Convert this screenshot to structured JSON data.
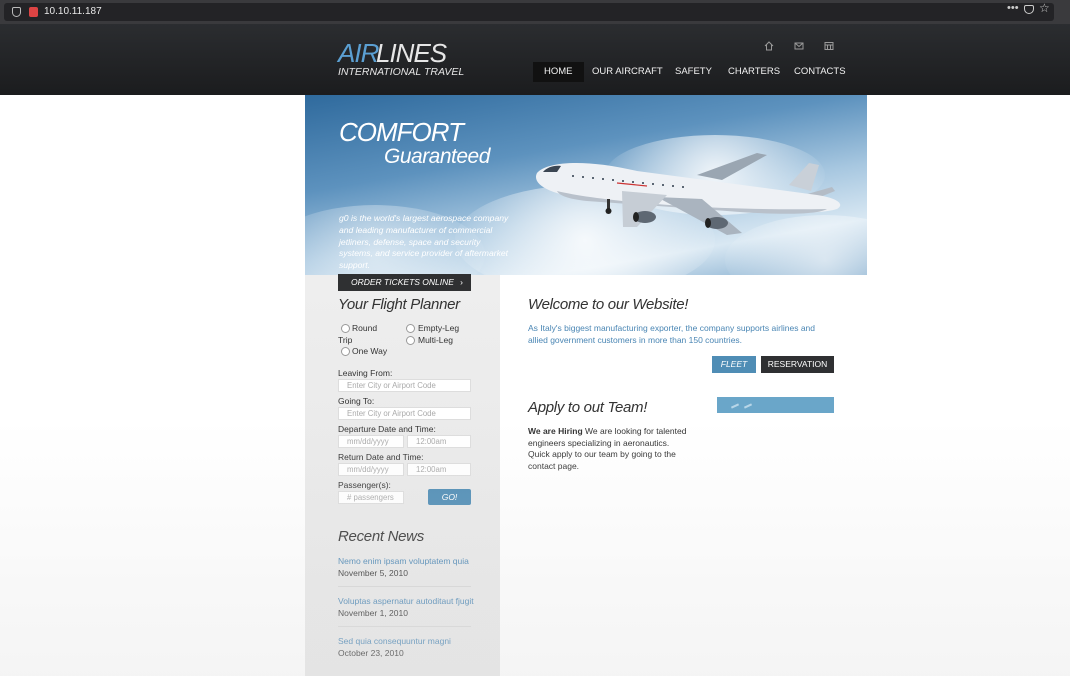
{
  "browser": {
    "url": "10.10.11.187",
    "menu_icon": "•••",
    "bookmark_icon": "☆"
  },
  "header": {
    "logo_air": "AIR",
    "logo_lines": "LINES",
    "logo_sub": "INTERNATIONAL TRAVEL",
    "icons": [
      "home-icon",
      "mail-icon",
      "sitemap-icon"
    ],
    "nav": [
      "HOME",
      "OUR AIRCRAFT",
      "SAFETY",
      "CHARTERS",
      "CONTACTS"
    ]
  },
  "hero": {
    "title": "COMFORT",
    "subtitle": "Guaranteed",
    "text": "g0 is the world's largest aerospace company and leading manufacturer of commercial jetliners, defense, space and security systems, and service provider of aftermarket support."
  },
  "sidebar": {
    "order_button": "ORDER TICKETS ONLINE",
    "order_chevron": "›",
    "planner_title": "Your Flight Planner",
    "trip_options": {
      "round": "Round",
      "trip": "Trip",
      "empty_leg": "Empty-Leg",
      "one_way": "One Way",
      "multi_leg": "Multi-Leg"
    },
    "leaving_label": "Leaving From:",
    "leaving_placeholder": "Enter City or Airport Code",
    "going_label": "Going To:",
    "going_placeholder": "Enter City or Airport Code",
    "departure_label": "Departure Date and Time:",
    "date_placeholder": "mm/dd/yyyy",
    "time_placeholder": "12:00am",
    "return_label": "Return Date and Time:",
    "passengers_label": "Passenger(s):",
    "passengers_placeholder": "# passengers",
    "go_button": "GO!",
    "news_title": "Recent News",
    "news": [
      {
        "title": "Nemo enim ipsam voluptatem quia",
        "date": "November 5, 2010"
      },
      {
        "title": "Voluptas aspernatur autoditaut fjugit",
        "date": "November 1, 2010"
      },
      {
        "title": "Sed quia consequuntur magni",
        "date": "October 23, 2010"
      }
    ]
  },
  "main": {
    "welcome_title": "Welcome to our Website!",
    "welcome_text": "As Italy's biggest manufacturing exporter, the company supports airlines and allied government customers in more than 150 countries.",
    "fleet_button": "FLEET",
    "reservation_button": "RESERVATION",
    "apply_title": "Apply to out Team!",
    "hiring_bold": "We are Hiring",
    "hiring_text": "We are looking for talented engineers specializing in aeronautics. Quick apply to our team by going to the contact page."
  },
  "colors": {
    "accent": "#4f8db5",
    "link": "#4a86b4",
    "header_bg": "#1b1c1e"
  }
}
